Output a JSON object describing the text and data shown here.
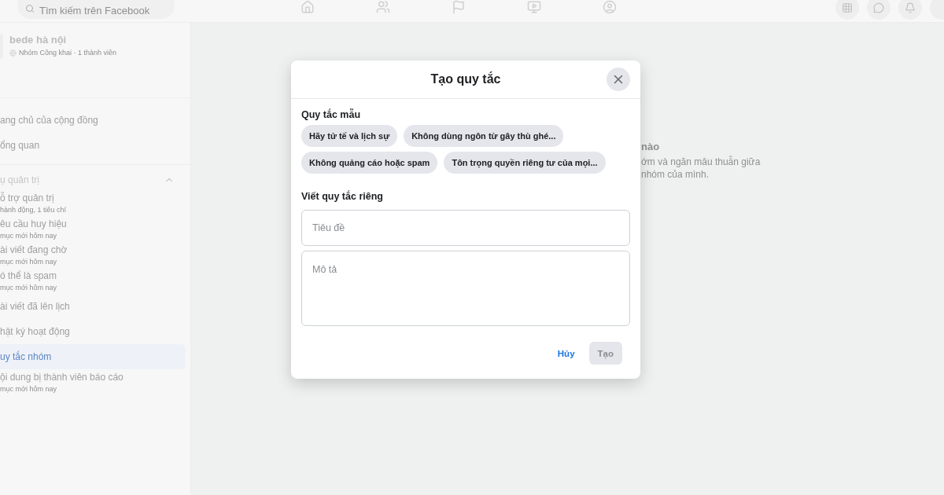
{
  "topbar": {
    "search": {
      "placeholder": "Tìm kiếm trên Facebook"
    }
  },
  "group": {
    "name": "bede hà nội",
    "meta": "Nhóm Công khai · 1 thành viên"
  },
  "nav": [
    {
      "label": "ang chủ của cộng đồng",
      "selected": false
    },
    {
      "label": "ổng quan",
      "selected": false
    }
  ],
  "admin_section": {
    "label": "ụ quản trị",
    "expanded": true,
    "items": [
      {
        "label": "ỗ trợ quản trị",
        "subtitle": "hành động, 1 tiêu chí",
        "selected": false
      },
      {
        "label": "êu cầu huy hiệu",
        "subtitle": "mục mới hôm nay",
        "selected": false
      },
      {
        "label": "ài viết đang chờ",
        "subtitle": "mục mới hôm nay",
        "selected": false
      },
      {
        "label": "ó thể là spam",
        "subtitle": "mục mới hôm nay",
        "selected": false
      },
      {
        "label": "ài viết đã lên lịch",
        "selected": false
      },
      {
        "label": "hật ký hoạt động",
        "selected": false
      },
      {
        "label": "uy tắc nhóm",
        "selected": true
      },
      {
        "label": "ội dung bị thành viên báo cáo",
        "subtitle": "mục mới hôm nay",
        "selected": false
      }
    ]
  },
  "main_hint": {
    "title": "nào",
    "lines": [
      "ớm và ngăn mâu thuẫn giữa",
      "nhóm của mình."
    ]
  },
  "modal": {
    "title": "Tạo quy tắc",
    "template_heading": "Quy tắc mẫu",
    "templates": [
      "Hãy tử tế và lịch sự",
      "Không dùng ngôn từ gây thù ghé...",
      "Không quảng cáo hoặc spam",
      "Tôn trọng quyền riêng tư của mọi..."
    ],
    "custom_heading": "Viết quy tắc riêng",
    "title_field": {
      "placeholder": "Tiêu đề"
    },
    "description_field": {
      "placeholder": "Mô tả"
    },
    "buttons": [
      {
        "label": "Hủy",
        "kind": "cancel",
        "disabled": false
      },
      {
        "label": "Tạo",
        "kind": "submit",
        "disabled": true
      }
    ]
  }
}
